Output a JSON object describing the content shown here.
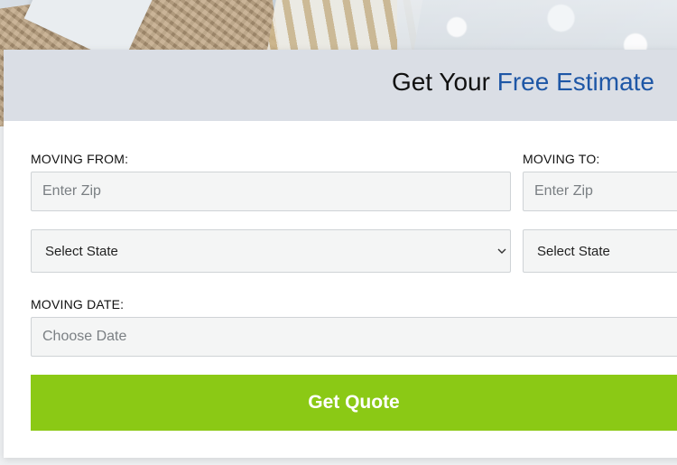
{
  "header": {
    "title_prefix": "Get Your ",
    "title_accent": "Free Estimate"
  },
  "form": {
    "moving_from": {
      "label": "MOVING FROM:",
      "zip_placeholder": "Enter Zip",
      "state_value": "Select State"
    },
    "moving_to": {
      "label": "MOVING TO:",
      "zip_placeholder": "Enter Zip",
      "state_value": "Select State"
    },
    "moving_date": {
      "label": "MOVING DATE:",
      "date_placeholder": "Choose Date"
    },
    "submit_label": "Get Quote"
  },
  "colors": {
    "accent_blue": "#1e57a6",
    "button_green": "#8bc915",
    "header_bg": "#dadee5"
  },
  "icons": {
    "state_dropdown": "chevron-down-icon"
  }
}
